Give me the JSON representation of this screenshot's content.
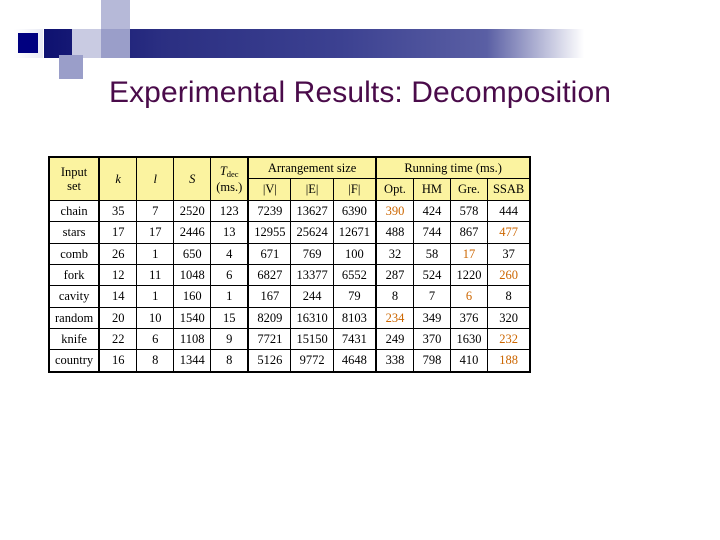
{
  "slide": {
    "title": "Experimental Results: Decomposition",
    "title_color": "#4a0b4a",
    "background_color": "#ffffff",
    "header_band_color": "#2b2f82",
    "header_accent_color": "#000080"
  },
  "table": {
    "header_background": "#fbf3a0",
    "highlight_color": "#cc6600",
    "group_headers": {
      "input_set": "Input\nset",
      "input_set_line1": "Input",
      "input_set_line2": "set",
      "k": "k",
      "l": "l",
      "S": "S",
      "tdec_main": "T",
      "tdec_sub": "dec",
      "tdec_unit": "(ms.)",
      "arrangement_size": "Arrangement size",
      "running_time": "Running time (ms.)"
    },
    "sub_headers": {
      "v": "|V|",
      "e": "|E|",
      "f": "|F|",
      "opt": "Opt.",
      "hm": "HM",
      "gre": "Gre.",
      "ssab": "SSAB"
    },
    "columns": [
      "Input set",
      "k",
      "l",
      "S",
      "Tdec (ms.)",
      "|V|",
      "|E|",
      "|F|",
      "Opt.",
      "HM",
      "Gre.",
      "SSAB"
    ],
    "rows": [
      {
        "name": "chain",
        "k": "35",
        "l": "7",
        "S": "2520",
        "tdec": "123",
        "v": "7239",
        "e": "13627",
        "f": "6390",
        "opt": "390",
        "hm": "424",
        "gre": "578",
        "ssab": "444",
        "best": "opt"
      },
      {
        "name": "stars",
        "k": "17",
        "l": "17",
        "S": "2446",
        "tdec": "13",
        "v": "12955",
        "e": "25624",
        "f": "12671",
        "opt": "488",
        "hm": "744",
        "gre": "867",
        "ssab": "477",
        "best": "ssab"
      },
      {
        "name": "comb",
        "k": "26",
        "l": "1",
        "S": "650",
        "tdec": "4",
        "v": "671",
        "e": "769",
        "f": "100",
        "opt": "32",
        "hm": "58",
        "gre": "17",
        "ssab": "37",
        "best": "gre"
      },
      {
        "name": "fork",
        "k": "12",
        "l": "11",
        "S": "1048",
        "tdec": "6",
        "v": "6827",
        "e": "13377",
        "f": "6552",
        "opt": "287",
        "hm": "524",
        "gre": "1220",
        "ssab": "260",
        "best": "ssab"
      },
      {
        "name": "cavity",
        "k": "14",
        "l": "1",
        "S": "160",
        "tdec": "1",
        "v": "167",
        "e": "244",
        "f": "79",
        "opt": "8",
        "hm": "7",
        "gre": "6",
        "ssab": "8",
        "best": "gre"
      },
      {
        "name": "random",
        "k": "20",
        "l": "10",
        "S": "1540",
        "tdec": "15",
        "v": "8209",
        "e": "16310",
        "f": "8103",
        "opt": "234",
        "hm": "349",
        "gre": "376",
        "ssab": "320",
        "best": "opt"
      },
      {
        "name": "knife",
        "k": "22",
        "l": "6",
        "S": "1108",
        "tdec": "9",
        "v": "7721",
        "e": "15150",
        "f": "7431",
        "opt": "249",
        "hm": "370",
        "gre": "1630",
        "ssab": "232",
        "best": "ssab"
      },
      {
        "name": "country",
        "k": "16",
        "l": "8",
        "S": "1344",
        "tdec": "8",
        "v": "5126",
        "e": "9772",
        "f": "4648",
        "opt": "338",
        "hm": "798",
        "gre": "410",
        "ssab": "188",
        "best": "ssab"
      }
    ]
  }
}
